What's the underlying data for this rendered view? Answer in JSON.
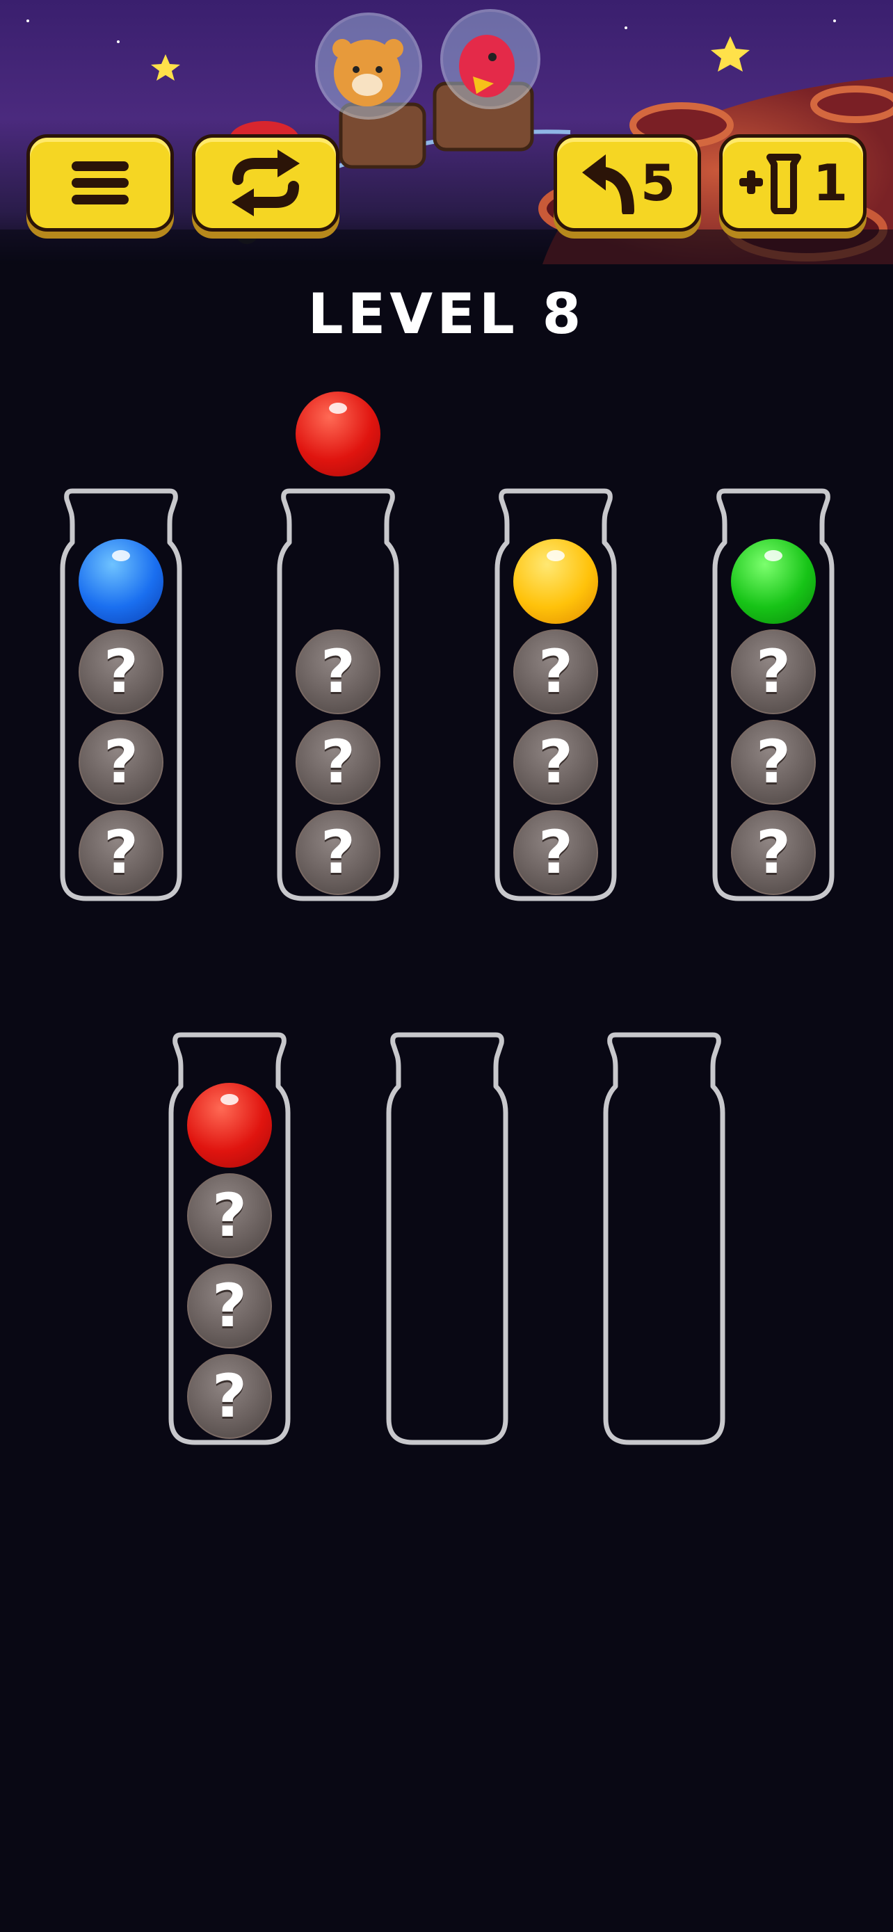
{
  "toolbar": {
    "menu_icon": "hamburger-menu-icon",
    "restart_icon": "restart-arrows-icon",
    "undo_icon": "undo-arrow-icon",
    "undo_count": "5",
    "add_tube_icon": "add-tube-icon",
    "add_tube_count": "1",
    "button_color": "#f5d623"
  },
  "level": {
    "title": "LEVEL 8"
  },
  "floating_ball": {
    "color": "red"
  },
  "colors": {
    "red": "#e0140f",
    "blue": "#1a6ff0",
    "yellow": "#ffc20a",
    "green": "#17c417",
    "hidden": "#6e6462",
    "tube_outline": "#c8c8cc"
  },
  "tubes": [
    {
      "balls": [
        "blue",
        "hidden",
        "hidden",
        "hidden"
      ]
    },
    {
      "balls": [
        "hidden",
        "hidden",
        "hidden"
      ]
    },
    {
      "balls": [
        "yellow",
        "hidden",
        "hidden",
        "hidden"
      ]
    },
    {
      "balls": [
        "green",
        "hidden",
        "hidden",
        "hidden"
      ]
    },
    {
      "balls": [
        "red",
        "hidden",
        "hidden",
        "hidden"
      ]
    },
    {
      "balls": []
    },
    {
      "balls": []
    }
  ],
  "hidden_mark": "?"
}
